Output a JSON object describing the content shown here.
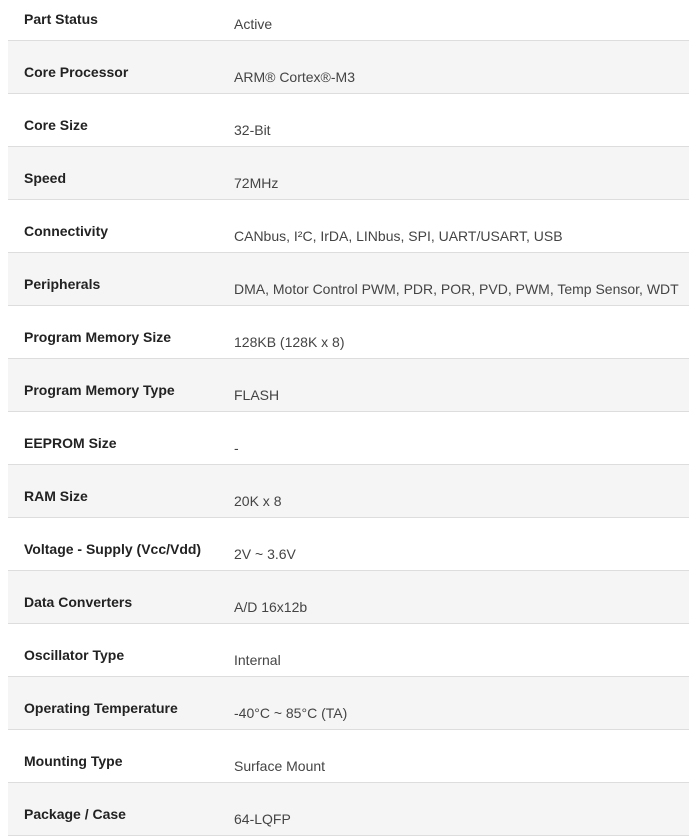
{
  "specs": [
    {
      "label": "Part Status",
      "value": "Active"
    },
    {
      "label": "Core Processor",
      "value": "ARM® Cortex®-M3"
    },
    {
      "label": "Core Size",
      "value": "32-Bit"
    },
    {
      "label": "Speed",
      "value": "72MHz"
    },
    {
      "label": "Connectivity",
      "value": "CANbus, I²C, IrDA, LINbus, SPI, UART/USART, USB"
    },
    {
      "label": "Peripherals",
      "value": "DMA, Motor Control PWM, PDR, POR, PVD, PWM, Temp Sensor, WDT"
    },
    {
      "label": "Program Memory Size",
      "value": "128KB (128K x 8)"
    },
    {
      "label": "Program Memory Type",
      "value": "FLASH"
    },
    {
      "label": "EEPROM Size",
      "value": "-"
    },
    {
      "label": "RAM Size",
      "value": "20K x 8"
    },
    {
      "label": "Voltage - Supply (Vcc/Vdd)",
      "value": "2V ~ 3.6V"
    },
    {
      "label": "Data Converters",
      "value": "A/D 16x12b"
    },
    {
      "label": "Oscillator Type",
      "value": "Internal"
    },
    {
      "label": "Operating Temperature",
      "value": "-40°C ~ 85°C (TA)"
    },
    {
      "label": "Mounting Type",
      "value": "Surface Mount"
    },
    {
      "label": "Package / Case",
      "value": "64-LQFP"
    }
  ],
  "colors": {
    "row_alt_background": "#f5f5f5",
    "row_background": "#ffffff",
    "divider": "#dddddd",
    "label_text": "#222222",
    "value_text": "#444444"
  }
}
